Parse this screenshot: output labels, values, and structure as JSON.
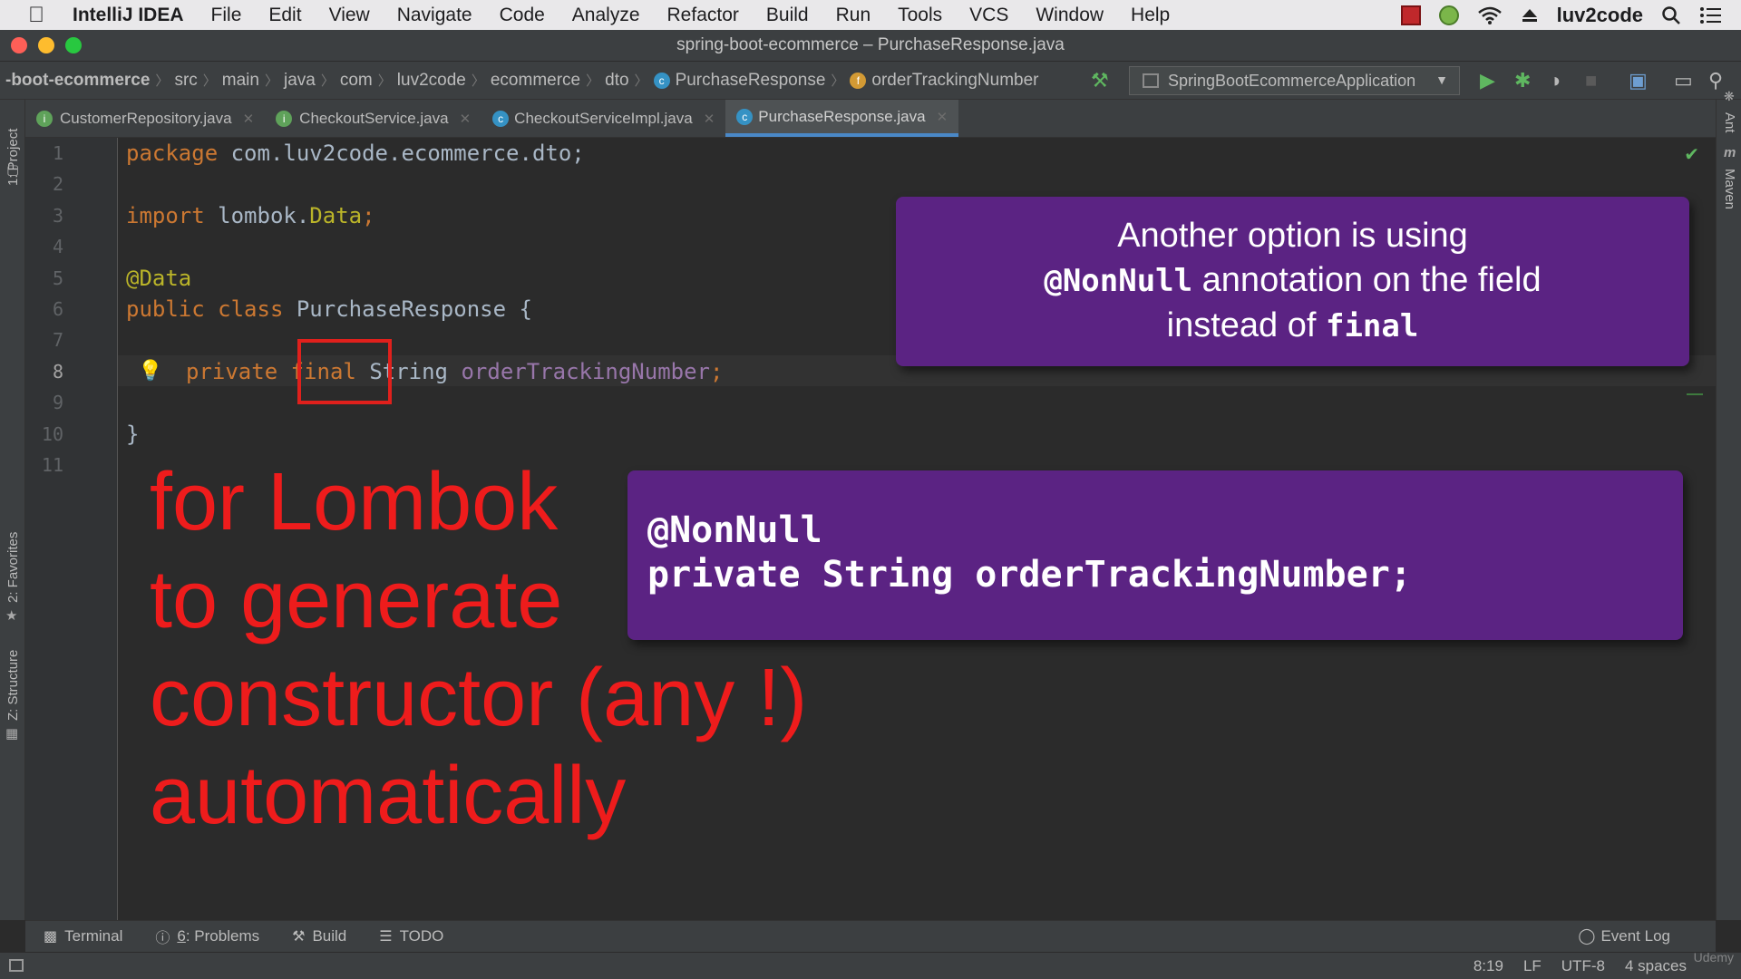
{
  "menubar": {
    "app_name": "IntelliJ IDEA",
    "items": [
      "File",
      "Edit",
      "View",
      "Navigate",
      "Code",
      "Analyze",
      "Refactor",
      "Build",
      "Run",
      "Tools",
      "VCS",
      "Window",
      "Help"
    ],
    "user": "luv2code"
  },
  "window": {
    "title": "spring-boot-ecommerce – PurchaseResponse.java"
  },
  "breadcrumb": {
    "items": [
      "-boot-ecommerce",
      "src",
      "main",
      "java",
      "com",
      "luv2code",
      "ecommerce",
      "dto",
      "PurchaseResponse",
      "orderTrackingNumber"
    ]
  },
  "run_config": {
    "name": "SpringBootEcommerceApplication"
  },
  "tabs": [
    {
      "label": "CustomerRepository.java",
      "icon": "interface-icon",
      "active": false
    },
    {
      "label": "CheckoutService.java",
      "icon": "interface-icon",
      "active": false
    },
    {
      "label": "CheckoutServiceImpl.java",
      "icon": "class-icon",
      "active": false
    },
    {
      "label": "PurchaseResponse.java",
      "icon": "class-icon",
      "active": true
    }
  ],
  "side_tools": {
    "left_top": "1: Project",
    "left_mid": "2: Favorites",
    "left_bottom": "Z: Structure",
    "right_top": "Ant",
    "right_mid": "Maven"
  },
  "editor": {
    "line_numbers": [
      "1",
      "2",
      "3",
      "4",
      "5",
      "6",
      "7",
      "8",
      "9",
      "10",
      "11"
    ],
    "current_line": "8",
    "lines": {
      "l1_kw": "package",
      "l1_rest": " com.luv2code.ecommerce.dto;",
      "l3_kw": "import",
      "l3_pkg": " lombok.",
      "l3_cls": "Data",
      "l3_end": ";",
      "l5_ann": "@Data",
      "l6_kw1": "public",
      "l6_kw2": " class",
      "l6_rest": " PurchaseResponse {",
      "l8_kw1": "private",
      "l8_kw2": "final",
      "l8_type": "String",
      "l8_field": "orderTrackingNumber",
      "l8_end": ";",
      "l10": "}"
    }
  },
  "overlays": {
    "callout1": {
      "line1": "Another option is using",
      "line2_code": "@NonNull",
      "line2_rest": " annotation on the field",
      "line3_text": "instead of ",
      "line3_code": "final"
    },
    "callout2": {
      "line1": "@NonNull",
      "line2": "private String orderTrackingNumber;"
    },
    "red_note": [
      "for Lombok",
      "to generate",
      "constructor (any !)",
      "automatically"
    ]
  },
  "bottom_tools": {
    "terminal": "Terminal",
    "problems_num": "6",
    "problems_label": ": Problems",
    "build": "Build",
    "todo": "TODO",
    "event_log": "Event Log"
  },
  "status": {
    "position": "8:19",
    "line_sep": "LF",
    "encoding": "UTF-8",
    "indent": "4 spaces"
  },
  "watermark": "Udemy",
  "colors": {
    "keyword": "#cc7832",
    "annotation": "#bbb529",
    "field": "#9876aa",
    "callout_bg": "#5b2383",
    "red_note": "#ee1c1c"
  }
}
